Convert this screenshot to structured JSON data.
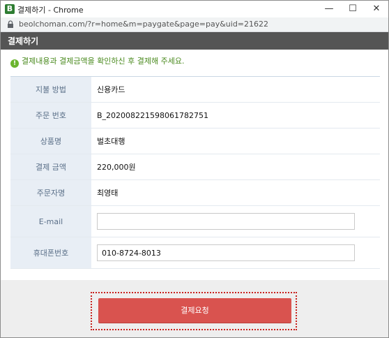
{
  "window": {
    "app_icon_letter": "B",
    "title": "결제하기 - Chrome",
    "minimize_glyph": "—",
    "maximize_glyph": "☐",
    "close_glyph": "✕",
    "url": "beolchoman.com/?r=home&m=paygate&page=pay&uid=21622",
    "accent": "#2e7d32"
  },
  "header": {
    "title": "결제하기",
    "background": "#555555"
  },
  "notice": {
    "icon": "info-icon",
    "icon_glyph": "!",
    "text": "결제내용과 결제금액을 확인하신 후 결제해 주세요."
  },
  "form": {
    "rows": [
      {
        "label": "지불 방법",
        "value": "신용카드"
      },
      {
        "label": "주문 번호",
        "value": "B_20200822159806178275 1"
      },
      {
        "label": "상품명",
        "value": "벌초대행"
      },
      {
        "label": "결제 금액",
        "value": "220,000원"
      },
      {
        "label": "주문자명",
        "value": "최영태"
      }
    ],
    "email": {
      "label": "E-mail",
      "value": ""
    },
    "phone": {
      "label": "휴대폰번호",
      "value": "010-8724-8013"
    }
  },
  "footer": {
    "pay_button_label": "결제요청",
    "pay_button_color": "#d9534f"
  }
}
